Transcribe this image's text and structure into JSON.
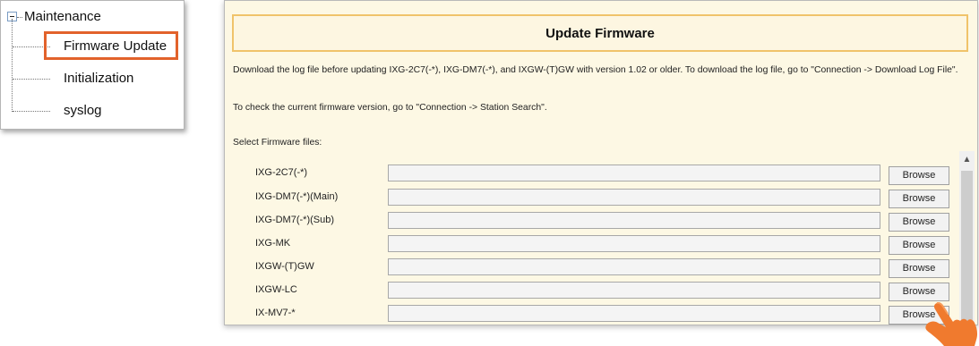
{
  "tree": {
    "root": {
      "label": "Maintenance"
    },
    "items": [
      {
        "label": "Firmware Update",
        "selected": true
      },
      {
        "label": "Initialization"
      },
      {
        "label": "syslog"
      }
    ],
    "highlight_color": "#e2622b"
  },
  "panel": {
    "title": "Update Firmware",
    "message_1": "Download the log file before updating IXG-2C7(-*), IXG-DM7(-*), and IXGW-(T)GW with version 1.02 or older. To download the log file, go to \"Connection -> Download Log File\".",
    "message_2": "To check the current firmware version, go to \"Connection -> Station Search\".",
    "select_label": "Select Firmware files:",
    "rows": [
      {
        "label": "IXG-2C7(-*)",
        "value": "",
        "button": "Browse"
      },
      {
        "label": "IXG-DM7(-*)(Main)",
        "value": "",
        "button": "Browse"
      },
      {
        "label": "IXG-DM7(-*)(Sub)",
        "value": "",
        "button": "Browse"
      },
      {
        "label": "IXG-MK",
        "value": "",
        "button": "Browse"
      },
      {
        "label": "IXGW-(T)GW",
        "value": "",
        "button": "Browse"
      },
      {
        "label": "IXGW-LC",
        "value": "",
        "button": "Browse"
      },
      {
        "label": "IX-MV7-*",
        "value": "",
        "button": "Browse"
      }
    ],
    "background_color": "#fdf8e4",
    "title_border_color": "#f0c36a"
  },
  "icons": {
    "tree_toggle": "minus-box-icon",
    "scroll_up": "chevron-up-icon",
    "pointer": "pointing-hand-icon"
  },
  "pointer_color": "#f07a2e"
}
